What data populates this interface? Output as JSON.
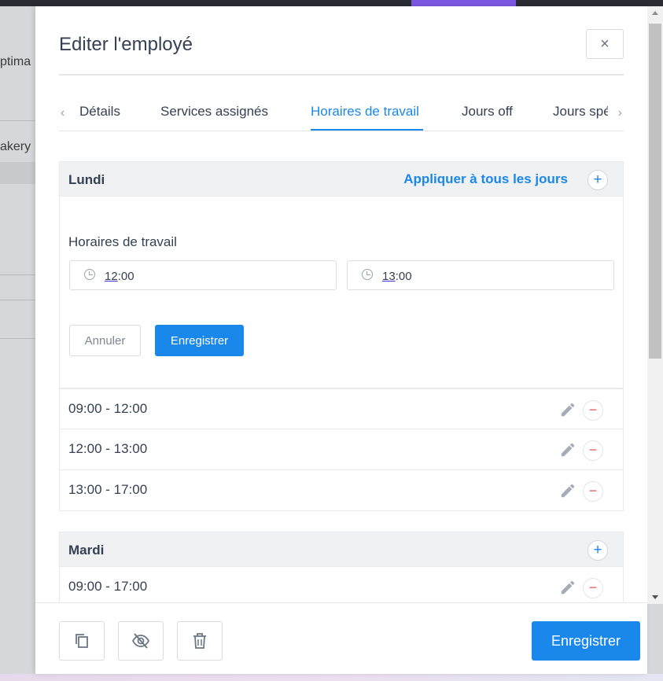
{
  "background": {
    "text1": "ptima",
    "text2": "akery P"
  },
  "drawer": {
    "title": "Editer l'employé",
    "close_label": "×"
  },
  "tabs": {
    "prev_label": "‹",
    "next_label": "›",
    "items": [
      {
        "label": "Détails",
        "active": false
      },
      {
        "label": "Services assignés",
        "active": false
      },
      {
        "label": "Horaires de travail",
        "active": true
      },
      {
        "label": "Jours off",
        "active": false
      },
      {
        "label": "Jours spéciaux",
        "active": false
      }
    ]
  },
  "monday": {
    "name": "Lundi",
    "apply_all": "Appliquer à tous les jours",
    "add_label": "+",
    "editor": {
      "label": "Horaires de travail",
      "start_hour": "12",
      "start_rest": ":00",
      "end_hour": "13",
      "end_rest": ":00",
      "cancel_label": "Annuler",
      "save_label": "Enregistrer"
    },
    "slots": [
      "09:00 - 12:00",
      "12:00 - 13:00",
      "13:00 - 17:00"
    ]
  },
  "tuesday": {
    "name": "Mardi",
    "add_label": "+",
    "slots": [
      "09:00 - 17:00"
    ]
  },
  "footer": {
    "save_label": "Enregistrer"
  },
  "colors": {
    "accent": "#1a87ea",
    "danger": "#e85a5a",
    "topbar_accent": "#7b57e0"
  },
  "icons": {
    "duplicate": "copy-icon",
    "hide": "eye-off-icon",
    "delete": "trash-icon",
    "edit": "pencil-icon",
    "time": "clock-icon"
  }
}
